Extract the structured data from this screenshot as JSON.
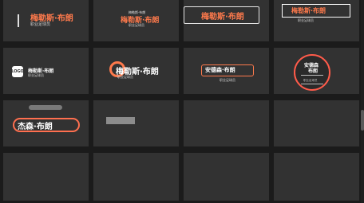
{
  "tiles": [
    {
      "title_main": "梅勒斯·布朗",
      "subtitle": "职业足球员"
    },
    {
      "small_top": "梅勒斯·布朗",
      "title_main": "梅勒斯·布朗",
      "subtitle": "职业足球员"
    },
    {
      "title_main": "梅勒斯·布朗"
    },
    {
      "title_main": "梅勒斯·布朗",
      "subtitle": "职业足球员"
    },
    {
      "badge": "LOGO",
      "title_main": "梅勒斯·布朗",
      "subtitle": "职业足球员"
    },
    {
      "title_main": "梅勒斯·布朗",
      "subtitle": "职业足球员"
    },
    {
      "title_main": "安德森·布朗",
      "subtitle": "职业足球员"
    },
    {
      "title_line1": "安德森",
      "title_line2": "布朗",
      "subtitle": "职业足球员"
    },
    {
      "title_main": "杰森·布朗"
    },
    {},
    {},
    {},
    {},
    {},
    {},
    {}
  ],
  "colors": {
    "accent": "#ff7a4c",
    "tile_bg": "#323232",
    "page_bg": "#1b1b1b"
  }
}
